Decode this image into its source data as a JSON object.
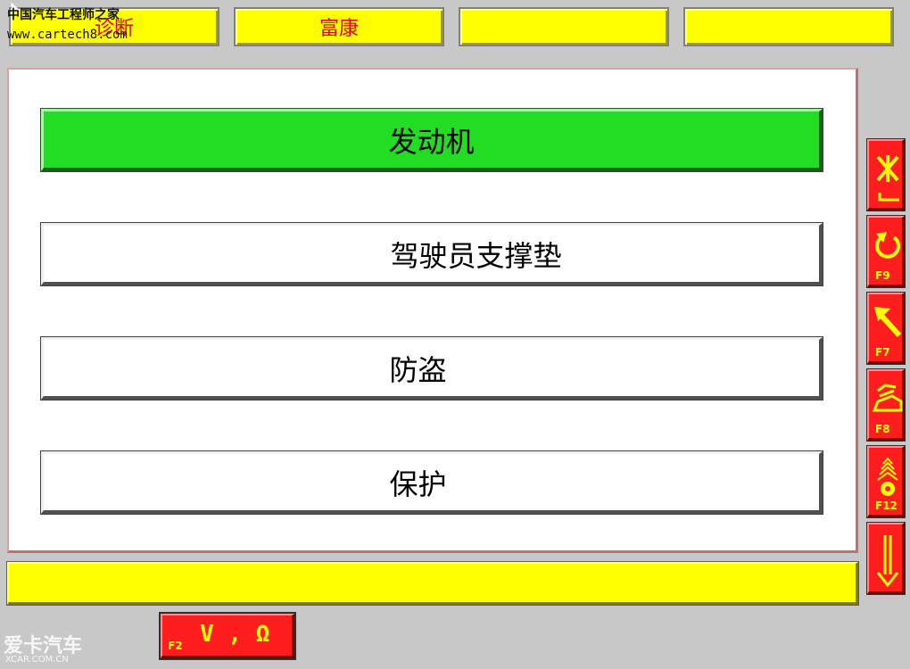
{
  "tabs": [
    {
      "label": "诊断"
    },
    {
      "label": "富康"
    },
    {
      "label": ""
    },
    {
      "label": ""
    }
  ],
  "watermark": {
    "line1": "中国汽车工程师之家",
    "line2": "www.cartech8.com",
    "bottom_logo": "爱卡汽车",
    "bottom_url": "XCAR.COM.CN"
  },
  "menu": {
    "items": [
      {
        "label": "发动机",
        "active": true
      },
      {
        "label": "驾驶员支撑垫",
        "active": false
      },
      {
        "label": "防盗",
        "active": false
      },
      {
        "label": "保护",
        "active": false
      }
    ]
  },
  "side_buttons": [
    {
      "icon": "cancel-enter-icon",
      "key": ""
    },
    {
      "icon": "undo-icon",
      "key": "F9"
    },
    {
      "icon": "arrow-up-left-icon",
      "key": "F7"
    },
    {
      "icon": "vehicle-icon",
      "key": "F8"
    },
    {
      "icon": "antenna-icon",
      "key": "F12"
    },
    {
      "icon": "arrow-down-icon",
      "key": ""
    }
  ],
  "status_bar": {
    "text": ""
  },
  "meter_button": {
    "key": "F2",
    "label": "V , Ω"
  },
  "colors": {
    "background": "#c8c8c8",
    "tab": "#ffff00",
    "tab_text": "#e00000",
    "active_item": "#22dd22",
    "side_button": "#ff1e1e",
    "icon": "#ffff00"
  }
}
